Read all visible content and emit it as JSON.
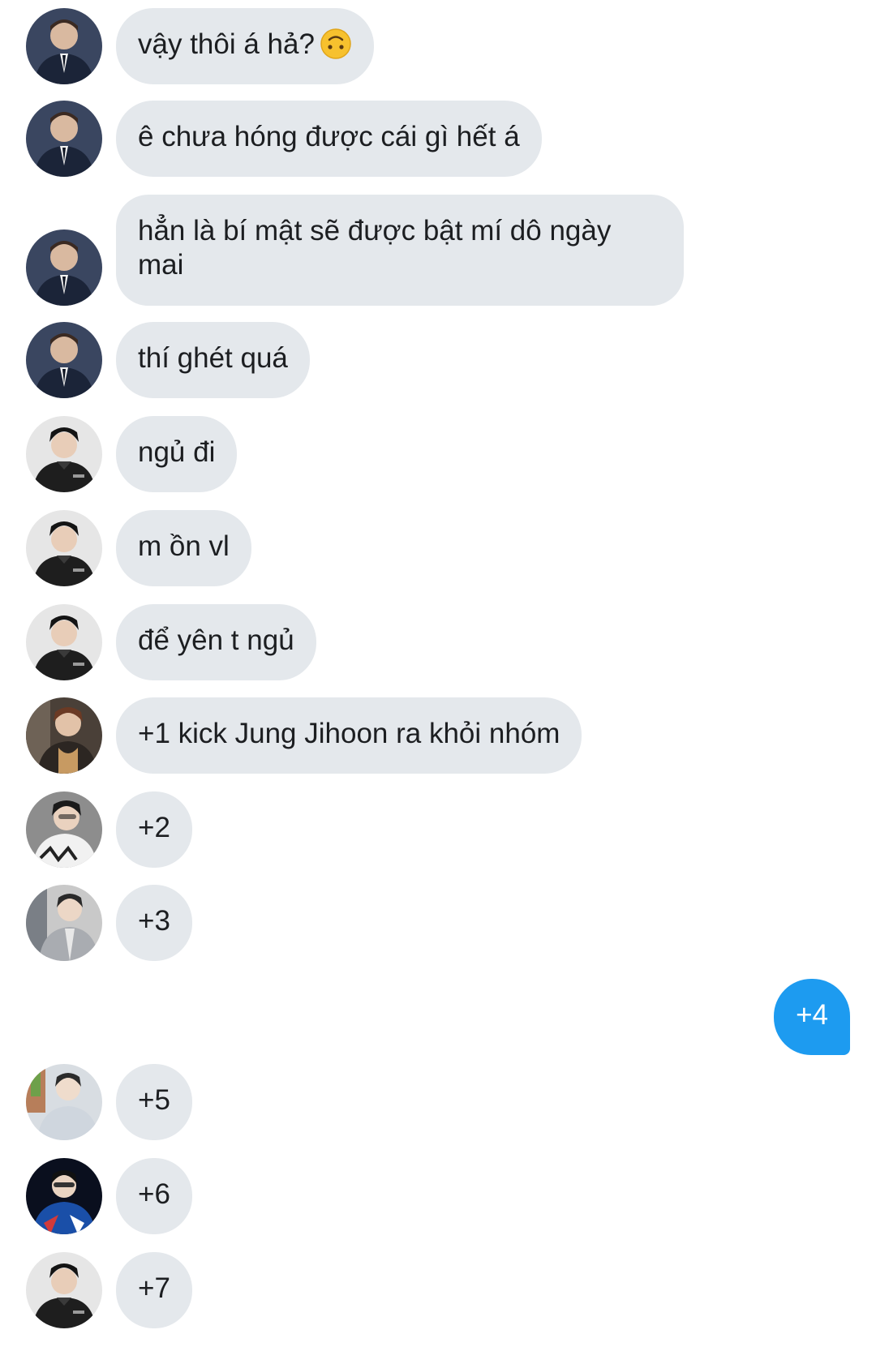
{
  "messages": [
    {
      "sender": "incoming",
      "avatar": "avatar-suit",
      "text": "vậy thôi á hả?",
      "emoji": "upside-down-face-icon"
    },
    {
      "sender": "incoming",
      "avatar": "avatar-suit",
      "text": "ê chưa hóng được cái gì hết á"
    },
    {
      "sender": "incoming",
      "avatar": "avatar-suit",
      "text": "hẳn là bí mật sẽ được bật mí dô ngày mai"
    },
    {
      "sender": "incoming",
      "avatar": "avatar-suit",
      "text": "thí ghét quá"
    },
    {
      "sender": "incoming",
      "avatar": "avatar-dark-jacket",
      "text": "ngủ đi"
    },
    {
      "sender": "incoming",
      "avatar": "avatar-dark-jacket",
      "text": "m ồn vl"
    },
    {
      "sender": "incoming",
      "avatar": "avatar-dark-jacket",
      "text": "để yên t ngủ"
    },
    {
      "sender": "incoming",
      "avatar": "avatar-brown-hair",
      "text": "+1 kick Jung Jihoon ra khỏi nhóm"
    },
    {
      "sender": "incoming",
      "avatar": "avatar-white-shirt",
      "text": "+2"
    },
    {
      "sender": "incoming",
      "avatar": "avatar-grey-jacket",
      "text": "+3"
    },
    {
      "sender": "outgoing",
      "text": "+4"
    },
    {
      "sender": "incoming",
      "avatar": "avatar-light-jacket",
      "text": "+5"
    },
    {
      "sender": "incoming",
      "avatar": "avatar-blue-jersey",
      "text": "+6"
    },
    {
      "sender": "incoming",
      "avatar": "avatar-dark-jacket",
      "text": "+7"
    }
  ],
  "colors": {
    "incoming_bubble": "#e4e8ec",
    "outgoing_bubble": "#1d9bf0",
    "incoming_text": "#1c1e21",
    "outgoing_text": "#ffffff"
  }
}
